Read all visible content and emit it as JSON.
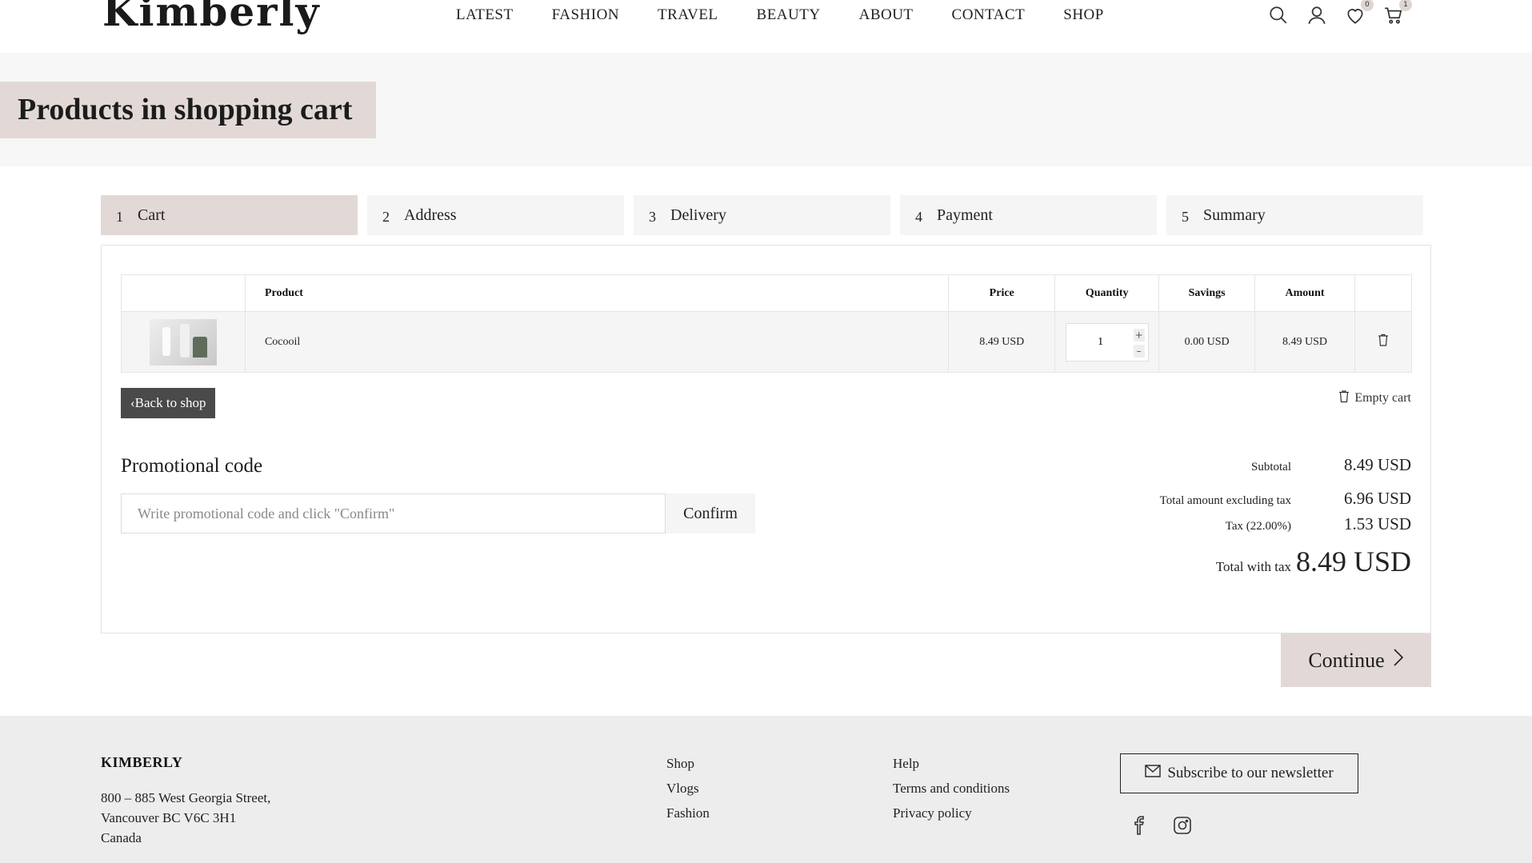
{
  "header": {
    "logo": "Kimberly",
    "nav": [
      "LATEST",
      "FASHION",
      "TRAVEL",
      "BEAUTY",
      "ABOUT",
      "CONTACT",
      "SHOP"
    ],
    "wishlist_count": "0",
    "cart_count": "1"
  },
  "hero": {
    "title": "Products in shopping cart"
  },
  "steps": [
    {
      "num": "1",
      "label": "Cart"
    },
    {
      "num": "2",
      "label": "Address"
    },
    {
      "num": "3",
      "label": "Delivery"
    },
    {
      "num": "4",
      "label": "Payment"
    },
    {
      "num": "5",
      "label": "Summary"
    }
  ],
  "table": {
    "headers": {
      "product": "Product",
      "price": "Price",
      "quantity": "Quantity",
      "savings": "Savings",
      "amount": "Amount"
    },
    "rows": [
      {
        "product": "Cocooil",
        "price": "8.49 USD",
        "quantity": "1",
        "savings": "0.00 USD",
        "amount": "8.49 USD"
      }
    ]
  },
  "actions": {
    "back_label": "Back to shop",
    "empty_label": "Empty cart",
    "continue_label": "Continue"
  },
  "promo": {
    "title": "Promotional code",
    "placeholder": "Write promotional code and click \"Confirm\"",
    "confirm_label": "Confirm"
  },
  "totals": {
    "subtotal_label": "Subtotal",
    "subtotal": "8.49 USD",
    "excl_label": "Total amount excluding tax",
    "excl": "6.96 USD",
    "tax_label": "Tax (22.00%)",
    "tax": "1.53 USD",
    "total_label": "Total with tax",
    "total": "8.49 USD"
  },
  "footer": {
    "brand": "KIMBERLY",
    "address": [
      "800 – 885 West Georgia Street,",
      "Vancouver BC V6C 3H1",
      "Canada"
    ],
    "col1": [
      "Shop",
      "Vlogs",
      "Fashion"
    ],
    "col2": [
      "Help",
      "Terms and conditions",
      "Privacy policy"
    ],
    "newsletter_label": "Subscribe to our newsletter"
  },
  "icons": [
    "search-icon",
    "user-icon",
    "heart-icon",
    "cart-icon",
    "trash-icon",
    "mail-icon",
    "facebook-icon",
    "instagram-icon"
  ],
  "colors": {
    "accent": "#e2d9d6",
    "hero_bg": "#f7f7f7",
    "footer_bg": "#eeeded",
    "back_button": "#4a4a4a"
  }
}
